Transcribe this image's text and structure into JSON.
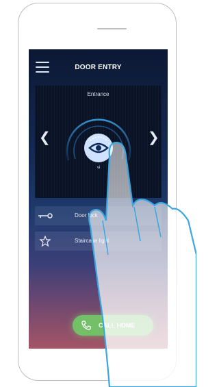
{
  "app": {
    "title": "DOOR ENTRY",
    "accent": "#3aa6e0",
    "call_color": "#74c069"
  },
  "panel": {
    "title": "Entrance",
    "center_icon": "eye-icon",
    "center_label": "vi"
  },
  "rows": [
    {
      "icon": "key-icon",
      "label": "Door lock"
    },
    {
      "icon": "star-icon",
      "label": "Staircase light"
    }
  ],
  "call_button": {
    "icon": "phone-icon",
    "label": "CALL HOME"
  }
}
